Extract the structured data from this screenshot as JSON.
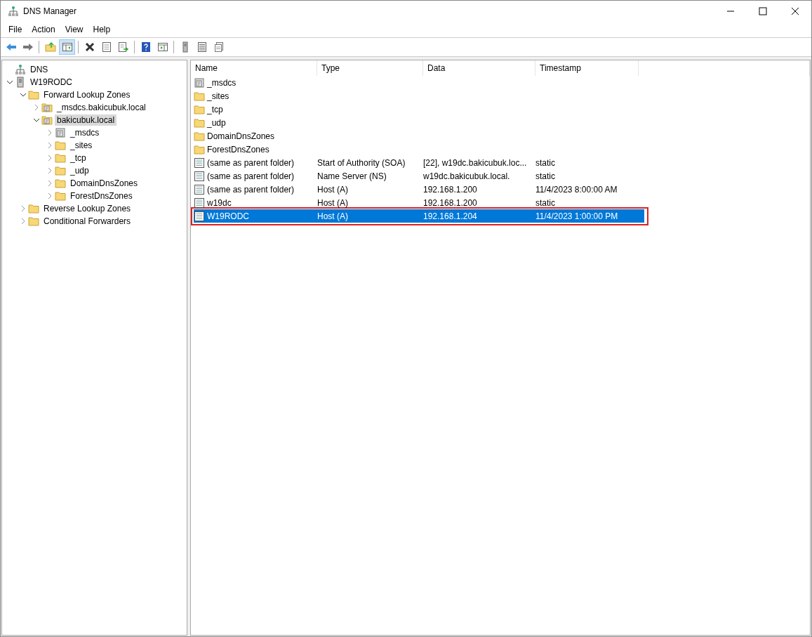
{
  "window": {
    "title": "DNS Manager"
  },
  "menu": [
    "File",
    "Action",
    "View",
    "Help"
  ],
  "toolbar": [
    {
      "kind": "back",
      "pressed": false
    },
    {
      "kind": "forward",
      "pressed": false
    },
    {
      "kind": "sep"
    },
    {
      "kind": "up",
      "pressed": false
    },
    {
      "kind": "tree",
      "pressed": true
    },
    {
      "kind": "sep"
    },
    {
      "kind": "delete",
      "pressed": false
    },
    {
      "kind": "properties",
      "pressed": false
    },
    {
      "kind": "export",
      "pressed": false
    },
    {
      "kind": "sep"
    },
    {
      "kind": "help",
      "pressed": false
    },
    {
      "kind": "actionpane",
      "pressed": false
    },
    {
      "kind": "sep"
    },
    {
      "kind": "server",
      "pressed": false
    },
    {
      "kind": "list",
      "pressed": false
    },
    {
      "kind": "copy",
      "pressed": false
    }
  ],
  "tree": [
    {
      "label": "DNS",
      "kind": "dns",
      "selected": false,
      "children": [
        {
          "label": "W19RODC",
          "kind": "server",
          "expanded": true,
          "selected": false,
          "children": [
            {
              "label": "Forward Lookup Zones",
              "kind": "folder",
              "expanded": true,
              "selected": false,
              "children": [
                {
                  "label": "_msdcs.bakicubuk.local",
                  "kind": "zone",
                  "expanded": false,
                  "selected": false
                },
                {
                  "label": "bakicubuk.local",
                  "kind": "zone",
                  "expanded": true,
                  "selected": true,
                  "children": [
                    {
                      "label": "_msdcs",
                      "kind": "delegation",
                      "expanded": false,
                      "selected": false
                    },
                    {
                      "label": "_sites",
                      "kind": "folder",
                      "expanded": false,
                      "selected": false
                    },
                    {
                      "label": "_tcp",
                      "kind": "folder",
                      "expanded": false,
                      "selected": false
                    },
                    {
                      "label": "_udp",
                      "kind": "folder",
                      "expanded": false,
                      "selected": false
                    },
                    {
                      "label": "DomainDnsZones",
                      "kind": "folder",
                      "expanded": false,
                      "selected": false
                    },
                    {
                      "label": "ForestDnsZones",
                      "kind": "folder",
                      "expanded": false,
                      "selected": false
                    }
                  ]
                }
              ]
            },
            {
              "label": "Reverse Lookup Zones",
              "kind": "folder",
              "expanded": false,
              "selected": false
            },
            {
              "label": "Conditional Forwarders",
              "kind": "folder",
              "expanded": false,
              "selected": false
            }
          ]
        }
      ]
    }
  ],
  "table": {
    "columns": [
      "Name",
      "Type",
      "Data",
      "Timestamp"
    ],
    "rows": [
      {
        "kind": "delegation",
        "name": "_msdcs",
        "selected": false,
        "highlighted": false
      },
      {
        "kind": "folder",
        "name": "_sites",
        "selected": false,
        "highlighted": false
      },
      {
        "kind": "folder",
        "name": "_tcp",
        "selected": false,
        "highlighted": false
      },
      {
        "kind": "folder",
        "name": "_udp",
        "selected": false,
        "highlighted": false
      },
      {
        "kind": "folder",
        "name": "DomainDnsZones",
        "selected": false,
        "highlighted": false
      },
      {
        "kind": "folder",
        "name": "ForestDnsZones",
        "selected": false,
        "highlighted": false
      },
      {
        "kind": "record",
        "name": "(same as parent folder)",
        "type": "Start of Authority (SOA)",
        "data": "[22], w19dc.bakicubuk.loc...",
        "timestamp": "static",
        "selected": false,
        "highlighted": false
      },
      {
        "kind": "record",
        "name": "(same as parent folder)",
        "type": "Name Server (NS)",
        "data": "w19dc.bakicubuk.local.",
        "timestamp": "static",
        "selected": false,
        "highlighted": false
      },
      {
        "kind": "record",
        "name": "(same as parent folder)",
        "type": "Host (A)",
        "data": "192.168.1.200",
        "timestamp": "11/4/2023 8:00:00 AM",
        "selected": false,
        "highlighted": false
      },
      {
        "kind": "record",
        "name": "w19dc",
        "type": "Host (A)",
        "data": "192.168.1.200",
        "timestamp": "static",
        "selected": false,
        "highlighted": false
      },
      {
        "kind": "record",
        "name": "W19RODC",
        "type": "Host (A)",
        "data": "192.168.1.204",
        "timestamp": "11/4/2023 1:00:00 PM",
        "selected": true,
        "highlighted": true
      }
    ]
  }
}
